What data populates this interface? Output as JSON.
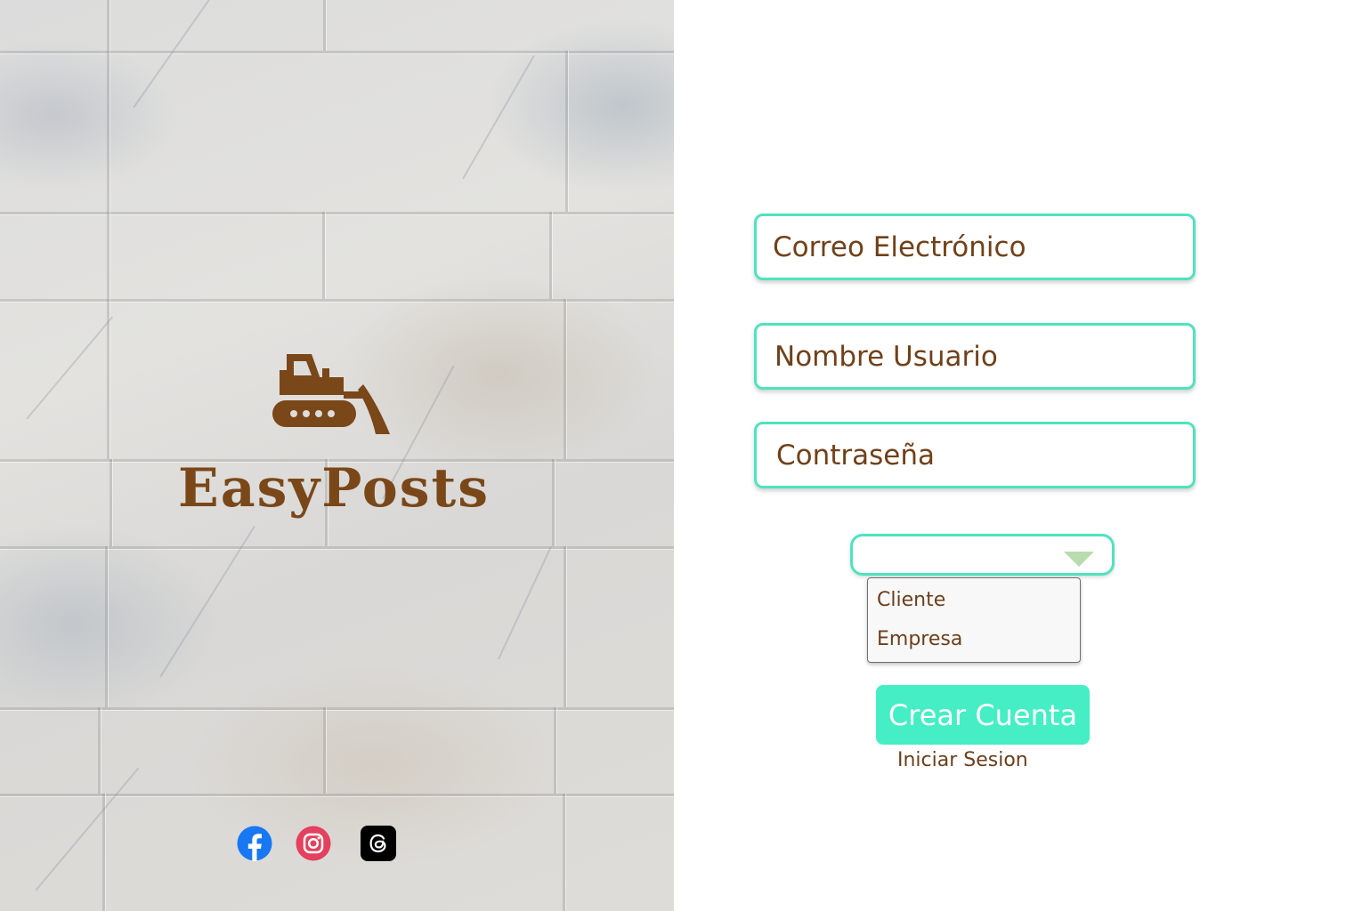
{
  "brand": {
    "name": "EasyPosts",
    "color": "#7a4719",
    "logo_icon": "bulldozer-icon"
  },
  "social": [
    {
      "name": "facebook",
      "icon": "facebook-icon",
      "color": "#1877f2"
    },
    {
      "name": "instagram",
      "icon": "instagram-icon",
      "color": "#e4405f"
    },
    {
      "name": "threads",
      "icon": "threads-icon",
      "color": "#000000"
    }
  ],
  "form": {
    "email_placeholder": "Correo Electrónico",
    "username_placeholder": "Nombre Usuario",
    "password_placeholder": "Contraseña",
    "account_type": {
      "selected": "",
      "options": [
        "Cliente",
        "Empresa"
      ]
    },
    "submit_label": "Crear Cuenta",
    "login_link": "Iniciar Sesion"
  },
  "colors": {
    "accent": "#45eec4",
    "field_border": "#4fe3be",
    "text_brown": "#70411a",
    "dropdown_arrow": "#b7dcae"
  }
}
